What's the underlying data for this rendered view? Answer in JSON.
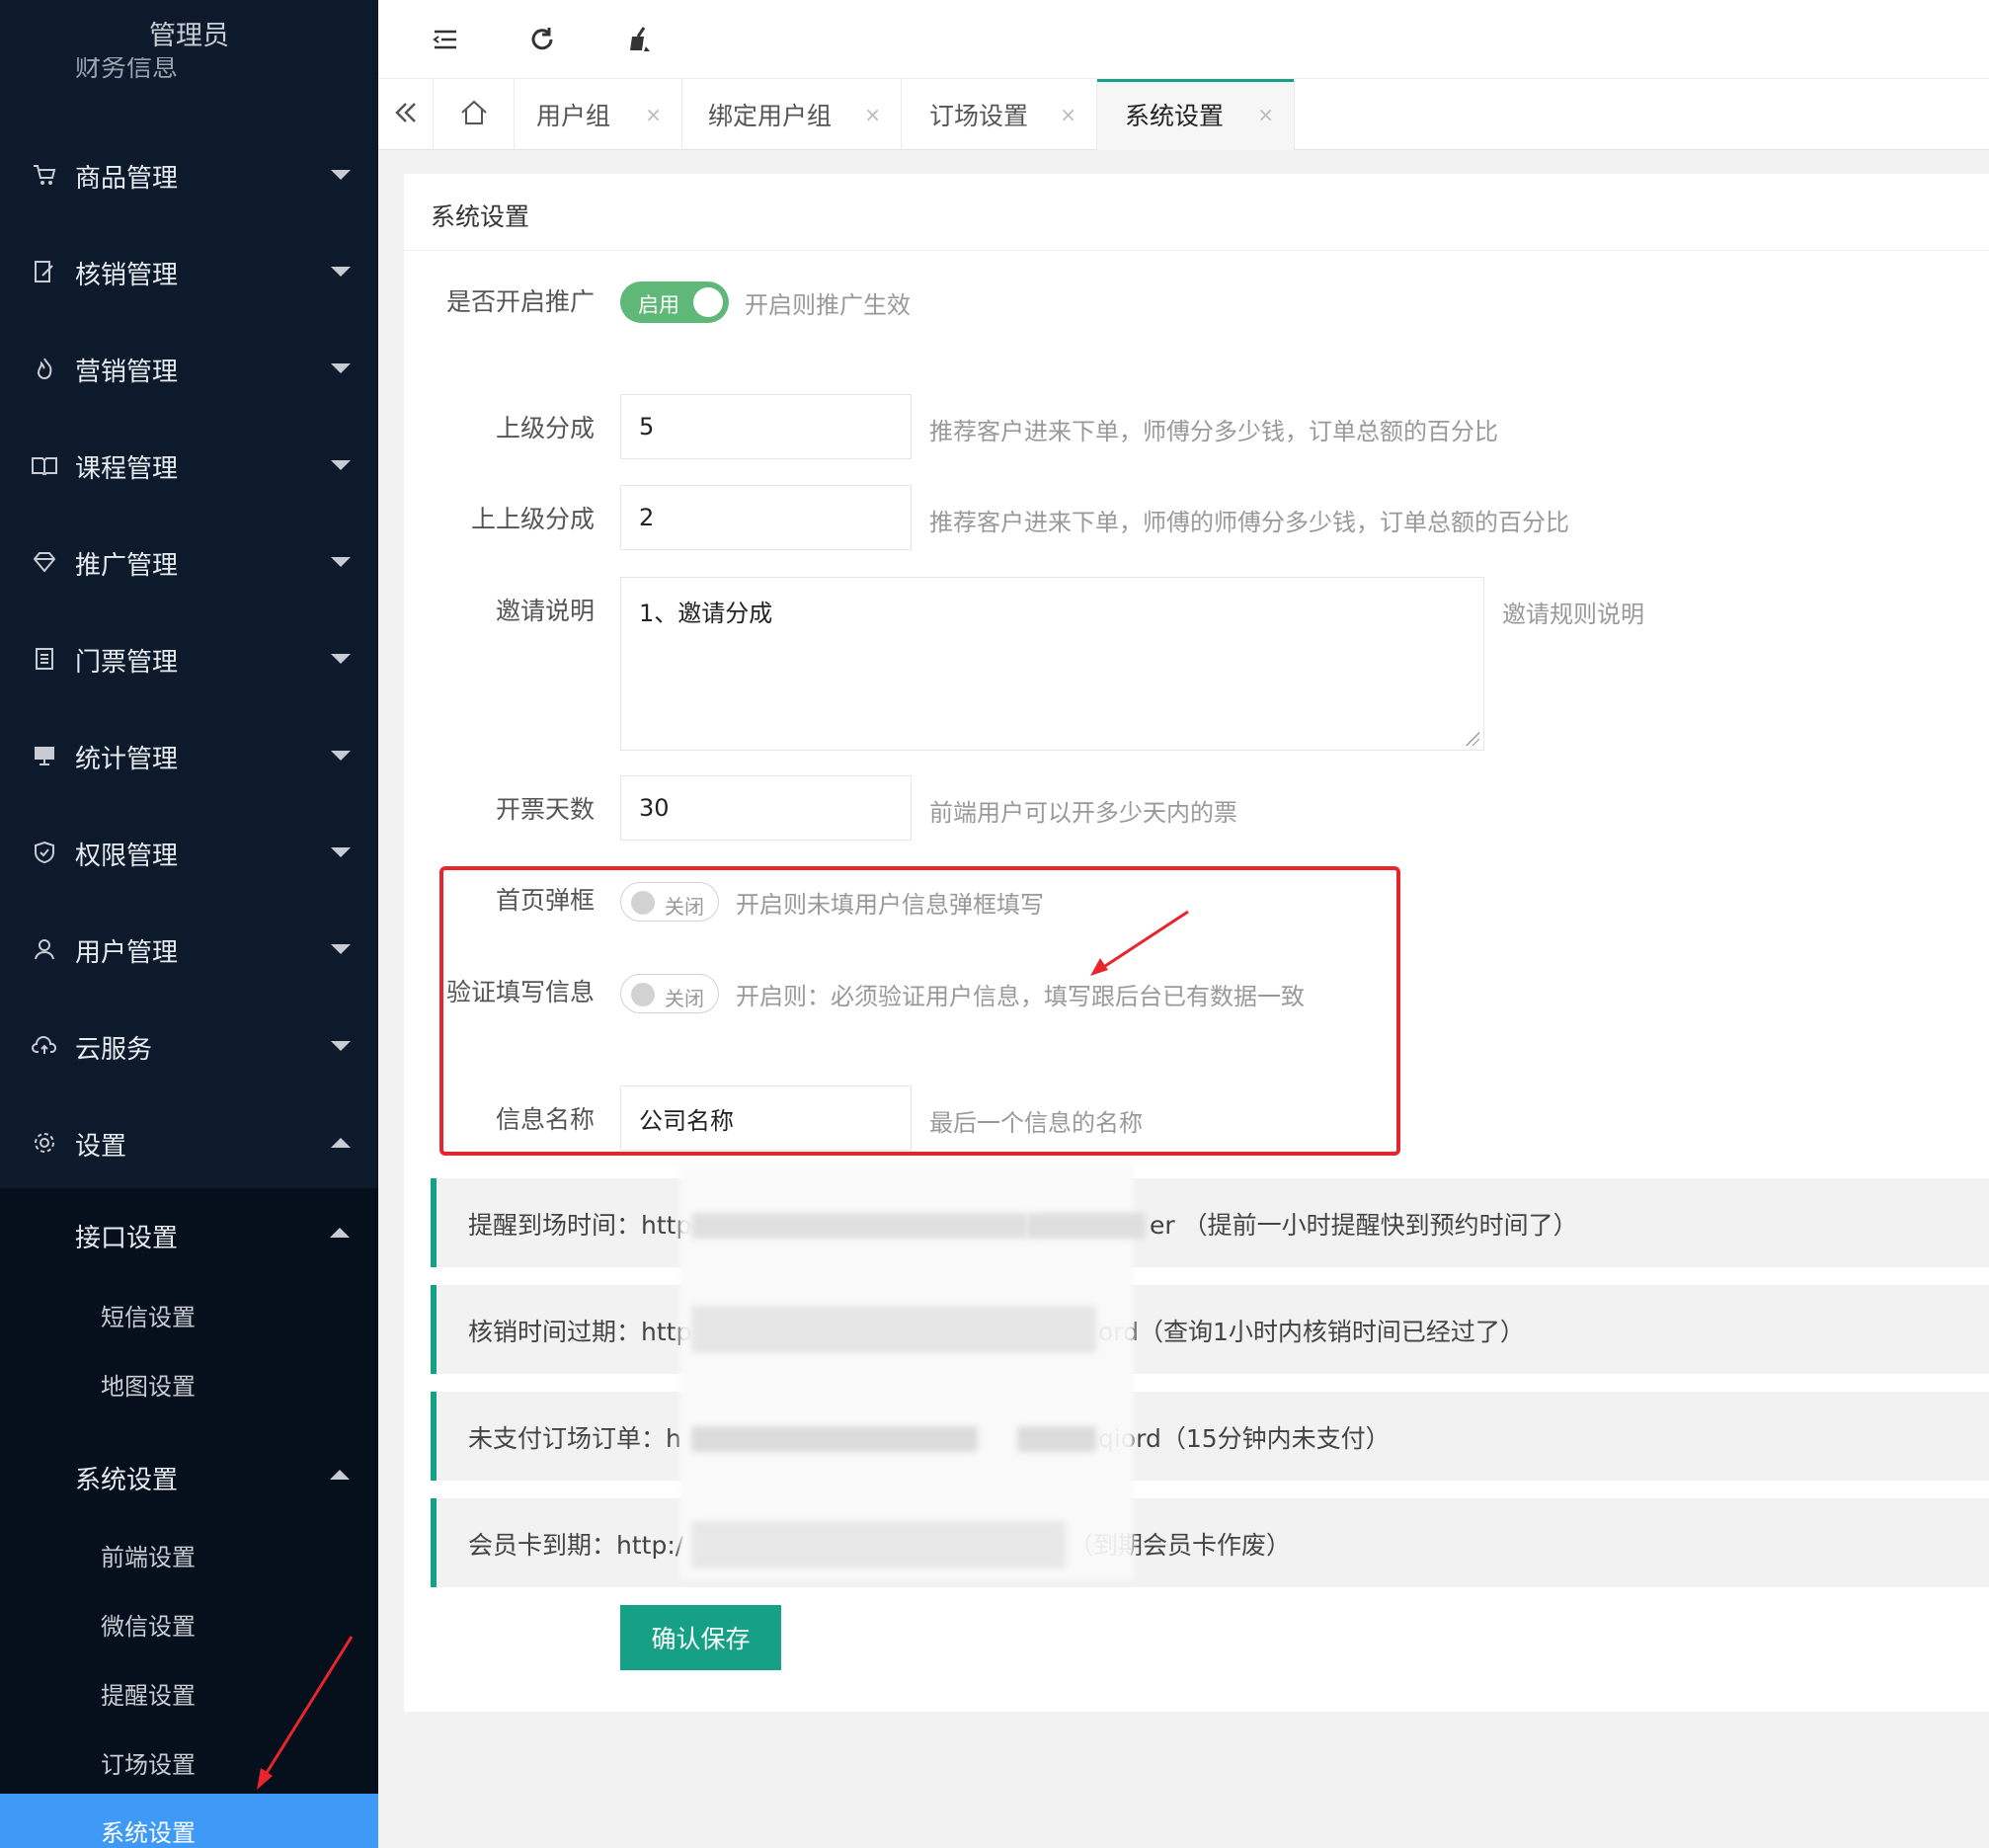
{
  "sidebar": {
    "title": "管理员",
    "partial_item": "财务信息",
    "menus": [
      {
        "label": "商品管理",
        "icon": "cart-icon"
      },
      {
        "label": "核销管理",
        "icon": "edit-doc-icon"
      },
      {
        "label": "营销管理",
        "icon": "fire-icon"
      },
      {
        "label": "课程管理",
        "icon": "book-icon"
      },
      {
        "label": "推广管理",
        "icon": "diamond-icon"
      },
      {
        "label": "门票管理",
        "icon": "ticket-icon"
      },
      {
        "label": "统计管理",
        "icon": "monitor-icon"
      },
      {
        "label": "权限管理",
        "icon": "shield-icon"
      },
      {
        "label": "用户管理",
        "icon": "user-icon"
      },
      {
        "label": "云服务",
        "icon": "cloud-icon"
      },
      {
        "label": "设置",
        "icon": "gear-icon"
      }
    ],
    "submenu": {
      "api_settings": "接口设置",
      "sms_settings": "短信设置",
      "map_settings": "地图设置",
      "system_settings": "系统设置",
      "frontend_settings": "前端设置",
      "wechat_settings": "微信设置",
      "reminder_settings": "提醒设置",
      "booking_settings": "订场设置",
      "system_settings_active": "系统设置"
    }
  },
  "toolbar": {
    "icons": [
      "menu-fold-icon",
      "refresh-icon",
      "clean-icon"
    ]
  },
  "tabs": [
    {
      "label": "用户组"
    },
    {
      "label": "绑定用户组"
    },
    {
      "label": "订场设置"
    },
    {
      "label": "系统设置",
      "active": true
    }
  ],
  "tab_close": "×",
  "card": {
    "title": "系统设置"
  },
  "form": {
    "promo": {
      "label": "是否开启推广",
      "switch_text": "启用",
      "on": true,
      "tip": "开启则推广生效"
    },
    "level1": {
      "label": "上级分成",
      "value": "5",
      "tip": "推荐客户进来下单，师傅分多少钱，订单总额的百分比"
    },
    "level2": {
      "label": "上上级分成",
      "value": "2",
      "tip": "推荐客户进来下单，师傅的师傅分多少钱，订单总额的百分比"
    },
    "invite": {
      "label": "邀请说明",
      "value": "1、邀请分成",
      "tip": "邀请规则说明"
    },
    "ticket_days": {
      "label": "开票天数",
      "value": "30",
      "tip": "前端用户可以开多少天内的票"
    },
    "popup": {
      "label": "首页弹框",
      "switch_text": "关闭",
      "on": false,
      "tip": "开启则未填用户信息弹框填写"
    },
    "verify": {
      "label": "验证填写信息",
      "switch_text": "关闭",
      "on": false,
      "tip": "开启则：必须验证用户信息，填写跟后台已有数据一致"
    },
    "info_name": {
      "label": "信息名称",
      "value": "公司名称",
      "tip": "最后一个信息的名称"
    }
  },
  "notes": [
    {
      "prefix": "提醒到场时间：http",
      "suffix": "er （提前一小时提醒快到预约时间了）"
    },
    {
      "prefix": "核销时间过期：http",
      "suffix": "ord（查询1小时内核销时间已经过了）"
    },
    {
      "prefix": "未支付订场订单：h",
      "suffix": "qiord（15分钟内未支付）"
    },
    {
      "prefix": "会员卡到期：http:/",
      "suffix": "（到期会员卡作废）"
    }
  ],
  "save_button": "确认保存",
  "colors": {
    "sidebar_bg": "#0c1a2c",
    "accent": "#16a085",
    "switch_on": "#5fb878",
    "active_menu": "#3f9af7",
    "highlight_box": "#e8242c"
  }
}
